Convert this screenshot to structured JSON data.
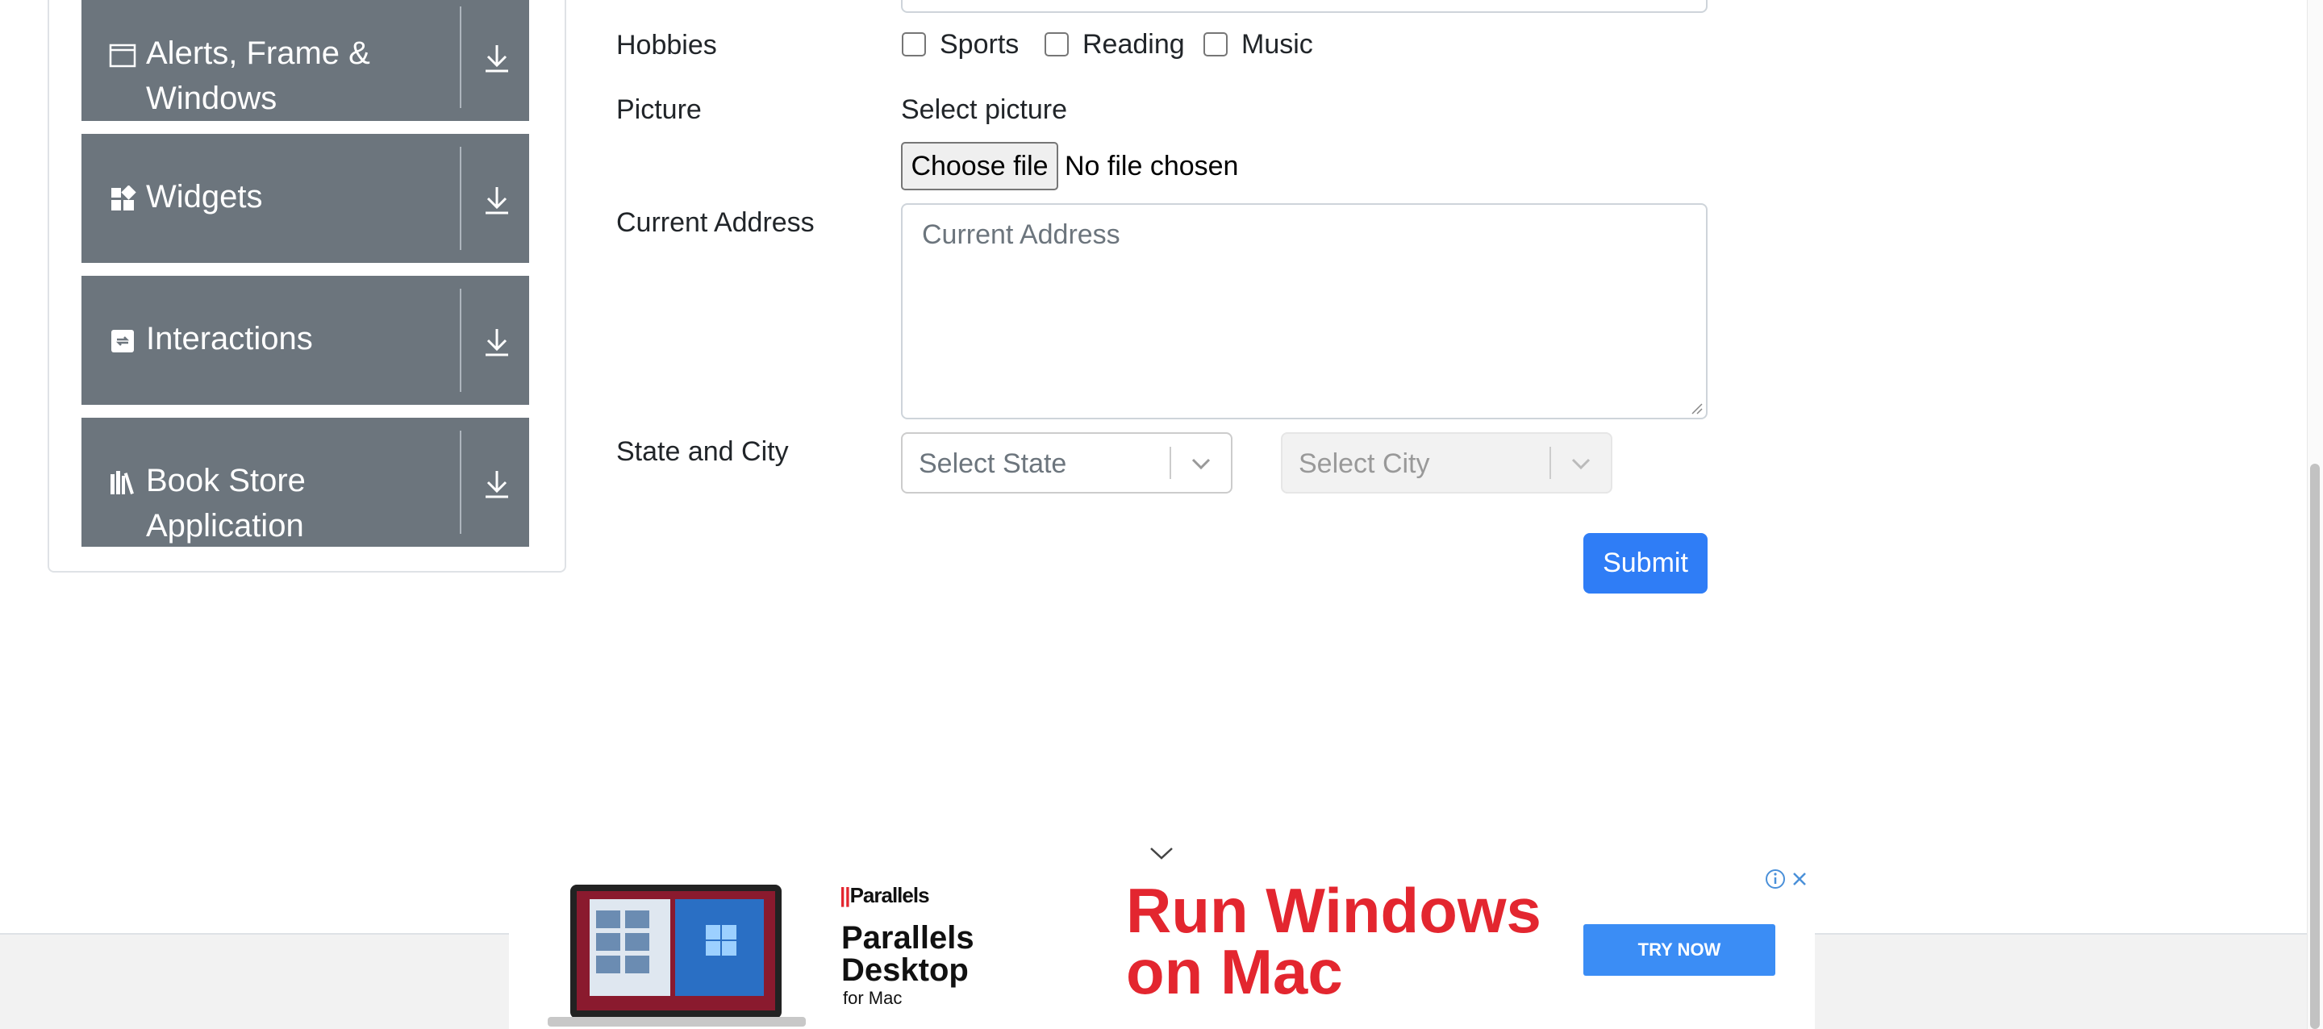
{
  "sidebar": {
    "groups": [
      {
        "label_line1": "Alerts, Frame &",
        "label_line2": "Windows",
        "icon": "window-icon"
      },
      {
        "label": "Widgets",
        "icon": "widgets-icon"
      },
      {
        "label": "Interactions",
        "icon": "interactions-icon"
      },
      {
        "label": "Book Store Application",
        "icon": "book-store-icon"
      }
    ]
  },
  "form": {
    "hobbies": {
      "label": "Hobbies",
      "options": [
        "Sports",
        "Reading",
        "Music"
      ]
    },
    "picture": {
      "label": "Picture",
      "select_label": "Select picture",
      "choose_button": "Choose file",
      "status": "No file chosen"
    },
    "address": {
      "label": "Current Address",
      "placeholder": "Current Address"
    },
    "state_city": {
      "label": "State and City",
      "state_placeholder": "Select State",
      "city_placeholder": "Select City"
    },
    "submit_label": "Submit"
  },
  "ad": {
    "brand_small": "Parallels",
    "brand_big_line1": "Parallels",
    "brand_big_line2": "Desktop",
    "brand_sub": "for Mac",
    "headline_line1": "Run Windows",
    "headline_line2": "on Mac",
    "cta": "TRY NOW"
  },
  "colors": {
    "accent": "#2f7df6",
    "sidebar_group": "#6c757d",
    "ad_red": "#e3262f"
  }
}
